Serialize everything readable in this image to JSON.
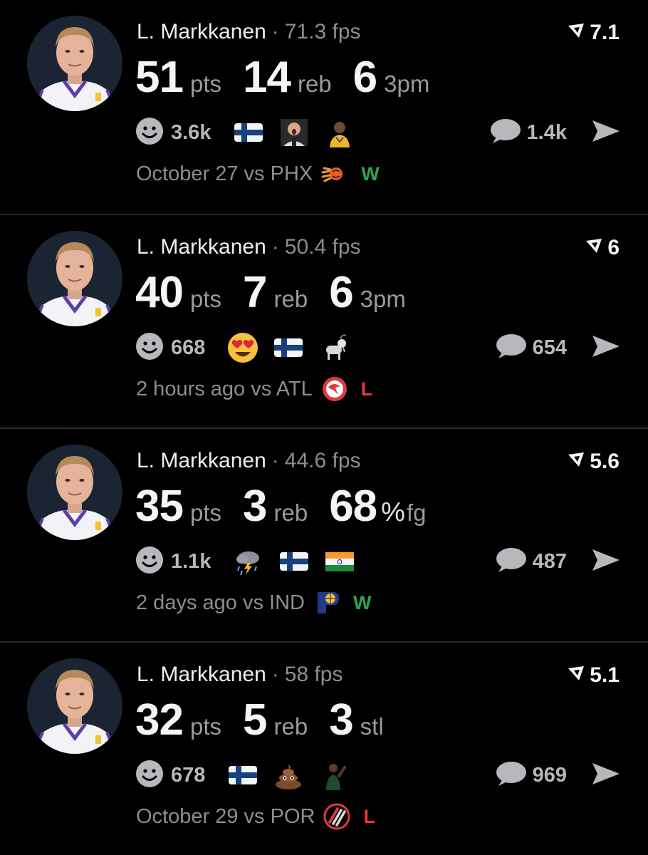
{
  "theme": {
    "win": "#2ea44f",
    "loss": "#e5383b",
    "muted": "#8d8d92"
  },
  "posts": [
    {
      "player": "L. Markkanen",
      "fps": "71.3 fps",
      "score": "7.1",
      "stats": [
        {
          "value": "51",
          "unit": "pts"
        },
        {
          "value": "14",
          "unit": "reb"
        },
        {
          "value": "6",
          "unit": "3pm"
        }
      ],
      "reaction_count": "3.6k",
      "reactions": [
        "finland-flag-icon",
        "announcer-sticker-icon",
        "lebron-sticker-icon"
      ],
      "comment_count": "1.4k",
      "time": "October 27",
      "vs": "vs PHX",
      "team_logo": "suns-logo-icon",
      "result": "W"
    },
    {
      "player": "L. Markkanen",
      "fps": "50.4 fps",
      "score": "6",
      "stats": [
        {
          "value": "40",
          "unit": "pts"
        },
        {
          "value": "7",
          "unit": "reb"
        },
        {
          "value": "6",
          "unit": "3pm"
        }
      ],
      "reaction_count": "668",
      "reactions": [
        "heart-eyes-icon",
        "finland-flag-icon",
        "goat-icon"
      ],
      "comment_count": "654",
      "time": "2 hours ago",
      "vs": "vs ATL",
      "team_logo": "hawks-logo-icon",
      "result": "L"
    },
    {
      "player": "L. Markkanen",
      "fps": "44.6 fps",
      "score": "5.6",
      "stats": [
        {
          "value": "35",
          "unit": "pts"
        },
        {
          "value": "3",
          "unit": "reb"
        },
        {
          "value": "68",
          "unit_pct": "%",
          "unit": "fg"
        }
      ],
      "reaction_count": "1.1k",
      "reactions": [
        "thunderstorm-icon",
        "finland-flag-icon",
        "india-flag-icon"
      ],
      "comment_count": "487",
      "time": "2 days ago",
      "vs": "vs IND",
      "team_logo": "pacers-logo-icon",
      "result": "W"
    },
    {
      "player": "L. Markkanen",
      "fps": "58 fps",
      "score": "5.1",
      "stats": [
        {
          "value": "32",
          "unit": "pts"
        },
        {
          "value": "5",
          "unit": "reb"
        },
        {
          "value": "3",
          "unit": "stl"
        }
      ],
      "reaction_count": "678",
      "reactions": [
        "finland-flag-icon",
        "poop-icon",
        "player-sticker-icon"
      ],
      "comment_count": "969",
      "time": "October 29",
      "vs": "vs POR",
      "team_logo": "blazers-logo-icon",
      "result": "L"
    }
  ]
}
